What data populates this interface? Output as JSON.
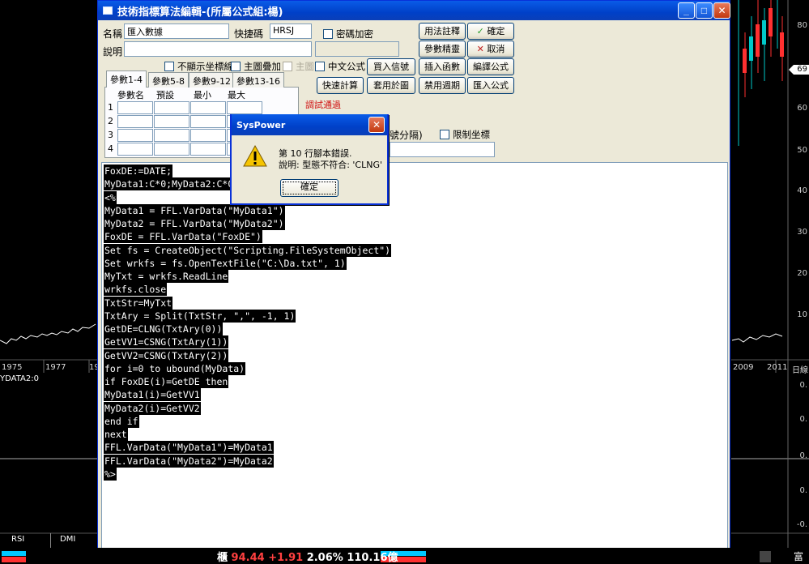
{
  "background_chart": {
    "left_year_labels": [
      "1975",
      "1977",
      "19"
    ],
    "right_year_labels": [
      "2009",
      "2011",
      "日線"
    ],
    "series_label": "YDATA2:0",
    "right_axis_top": [
      "80",
      "70",
      "60",
      "50",
      "40",
      "30",
      "20",
      "10"
    ],
    "right_axis_bottom": [
      "0.",
      "0.",
      "0.",
      "0.",
      "-0."
    ],
    "price_tag": "69",
    "indicator_tabs": [
      "RSI",
      "DMI"
    ]
  },
  "window": {
    "title": "技術指標算法編輯-(所屬公式組:楊)",
    "minimize_icon": "minimize-icon",
    "maximize_icon": "maximize-icon",
    "close_icon": "close-x-icon"
  },
  "form": {
    "name_label": "名稱",
    "name_value": "匯入數據",
    "shortcut_label": "快捷碼",
    "shortcut_value": "HRSJ",
    "password_label": "密碼加密",
    "desc_label": "說明",
    "hide_axis_label": "不顯示坐標線",
    "main_overlay_label": "主圖疊加",
    "main_label": "主圖",
    "chinese_formula_label": "中文公式",
    "compile_status": "調試通過",
    "separator_hint": "號分隔)",
    "limit_axis_label": "限制坐標"
  },
  "buttons": {
    "usage_notes": "用法註釋",
    "confirm": "確定",
    "param_wizard": "參數精靈",
    "cancel": "取消",
    "buy_signal": "買入信號",
    "insert_function": "插入函數",
    "compile_formula": "編譯公式",
    "quick_calc": "快速計算",
    "apply_to_chart": "套用於圖",
    "disable_period": "禁用週期",
    "import_formula": "匯入公式"
  },
  "param_tabs": [
    "參數1-4",
    "參數5-8",
    "參數9-12",
    "參數13-16"
  ],
  "param_grid": {
    "headers": [
      "參數名",
      "預設",
      "最小",
      "最大"
    ],
    "rows": [
      "1",
      "2",
      "3",
      "4"
    ]
  },
  "code_lines": [
    "FoxDE:=DATE;",
    "MyData1:C*0;MyData2:C*0;",
    "<%",
    "MyData1 = FFL.VarData(\"MyData1\")",
    "MyData2 = FFL.VarData(\"MyData2\")",
    "FoxDE = FFL.VarData(\"FoxDE\")",
    "Set fs = CreateObject(\"Scripting.FileSystemObject\")",
    "Set wrkfs = fs.OpenTextFile(\"C:\\Da.txt\", 1)",
    "MyTxt = wrkfs.ReadLine",
    "wrkfs.close",
    "TxtStr=MyTxt",
    "TxtAry = Split(TxtStr, \",\", -1, 1)",
    "GetDE=CLNG(TxtAry(0))",
    "GetVV1=CSNG(TxtAry(1))",
    "GetVV2=CSNG(TxtAry(2))",
    "for i=0 to ubound(MyData)",
    "if FoxDE(i)=GetDE then",
    "MyData1(i)=GetVV1",
    "MyData2(i)=GetVV2",
    "end if",
    "next",
    "FFL.VarData(\"MyData1\")=MyData1",
    "FFL.VarData(\"MyData2\")=MyData2",
    "%>"
  ],
  "alert": {
    "title": "SysPower",
    "line1": "第 10 行腳本錯誤.",
    "line2": "說明: 型態不符合: 'CLNG'",
    "ok_label": "確定",
    "icon": "warning-icon"
  },
  "status_bar": {
    "symbol": "櫃",
    "price": "94.44",
    "change": "+1.91",
    "percent": "2.06%",
    "volume": "110.16億",
    "right_text": "富",
    "colors": {
      "price": "#ff4040",
      "change": "#ff4040",
      "text": "#ffffff"
    }
  }
}
